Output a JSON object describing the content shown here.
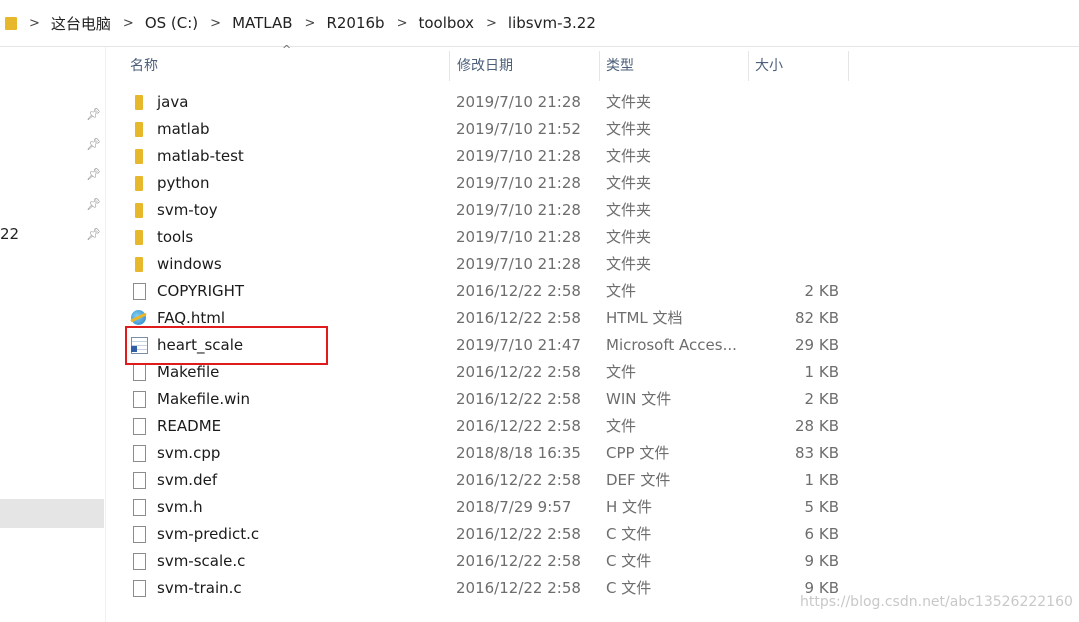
{
  "breadcrumb": [
    "这台电脑",
    "OS (C:)",
    "MATLAB",
    "R2016b",
    "toolbox",
    "libsvm-3.22"
  ],
  "nav": {
    "partial_label": "22"
  },
  "columns": {
    "name": "名称",
    "date": "修改日期",
    "type": "类型",
    "size": "大小"
  },
  "files": [
    {
      "name": "java",
      "date": "2019/7/10 21:28",
      "type": "文件夹",
      "size": "",
      "icon": "folder-icon"
    },
    {
      "name": "matlab",
      "date": "2019/7/10 21:52",
      "type": "文件夹",
      "size": "",
      "icon": "folder-icon"
    },
    {
      "name": "matlab-test",
      "date": "2019/7/10 21:28",
      "type": "文件夹",
      "size": "",
      "icon": "folder-icon"
    },
    {
      "name": "python",
      "date": "2019/7/10 21:28",
      "type": "文件夹",
      "size": "",
      "icon": "folder-icon"
    },
    {
      "name": "svm-toy",
      "date": "2019/7/10 21:28",
      "type": "文件夹",
      "size": "",
      "icon": "folder-icon"
    },
    {
      "name": "tools",
      "date": "2019/7/10 21:28",
      "type": "文件夹",
      "size": "",
      "icon": "folder-icon"
    },
    {
      "name": "windows",
      "date": "2019/7/10 21:28",
      "type": "文件夹",
      "size": "",
      "icon": "folder-icon"
    },
    {
      "name": "COPYRIGHT",
      "date": "2016/12/22 2:58",
      "type": "文件",
      "size": "2 KB",
      "icon": "file-icon"
    },
    {
      "name": "FAQ.html",
      "date": "2016/12/22 2:58",
      "type": "HTML 文档",
      "size": "82 KB",
      "icon": "html-icon"
    },
    {
      "name": "heart_scale",
      "date": "2019/7/10 21:47",
      "type": "Microsoft Acces...",
      "size": "29 KB",
      "icon": "access-icon"
    },
    {
      "name": "Makefile",
      "date": "2016/12/22 2:58",
      "type": "文件",
      "size": "1 KB",
      "icon": "file-icon"
    },
    {
      "name": "Makefile.win",
      "date": "2016/12/22 2:58",
      "type": "WIN 文件",
      "size": "2 KB",
      "icon": "file-icon"
    },
    {
      "name": "README",
      "date": "2016/12/22 2:58",
      "type": "文件",
      "size": "28 KB",
      "icon": "file-icon"
    },
    {
      "name": "svm.cpp",
      "date": "2018/8/18 16:35",
      "type": "CPP 文件",
      "size": "83 KB",
      "icon": "file-icon"
    },
    {
      "name": "svm.def",
      "date": "2016/12/22 2:58",
      "type": "DEF 文件",
      "size": "1 KB",
      "icon": "file-icon"
    },
    {
      "name": "svm.h",
      "date": "2018/7/29 9:57",
      "type": "H 文件",
      "size": "5 KB",
      "icon": "file-icon"
    },
    {
      "name": "svm-predict.c",
      "date": "2016/12/22 2:58",
      "type": "C 文件",
      "size": "6 KB",
      "icon": "file-icon"
    },
    {
      "name": "svm-scale.c",
      "date": "2016/12/22 2:58",
      "type": "C 文件",
      "size": "9 KB",
      "icon": "file-icon"
    },
    {
      "name": "svm-train.c",
      "date": "2016/12/22 2:58",
      "type": "C 文件",
      "size": "9 KB",
      "icon": "file-icon"
    }
  ],
  "watermark": "https://blog.csdn.net/abc13526222160",
  "colors": {
    "highlight": "#e01b1b",
    "folder": "#e8b82c",
    "header_text": "#4c607a"
  }
}
